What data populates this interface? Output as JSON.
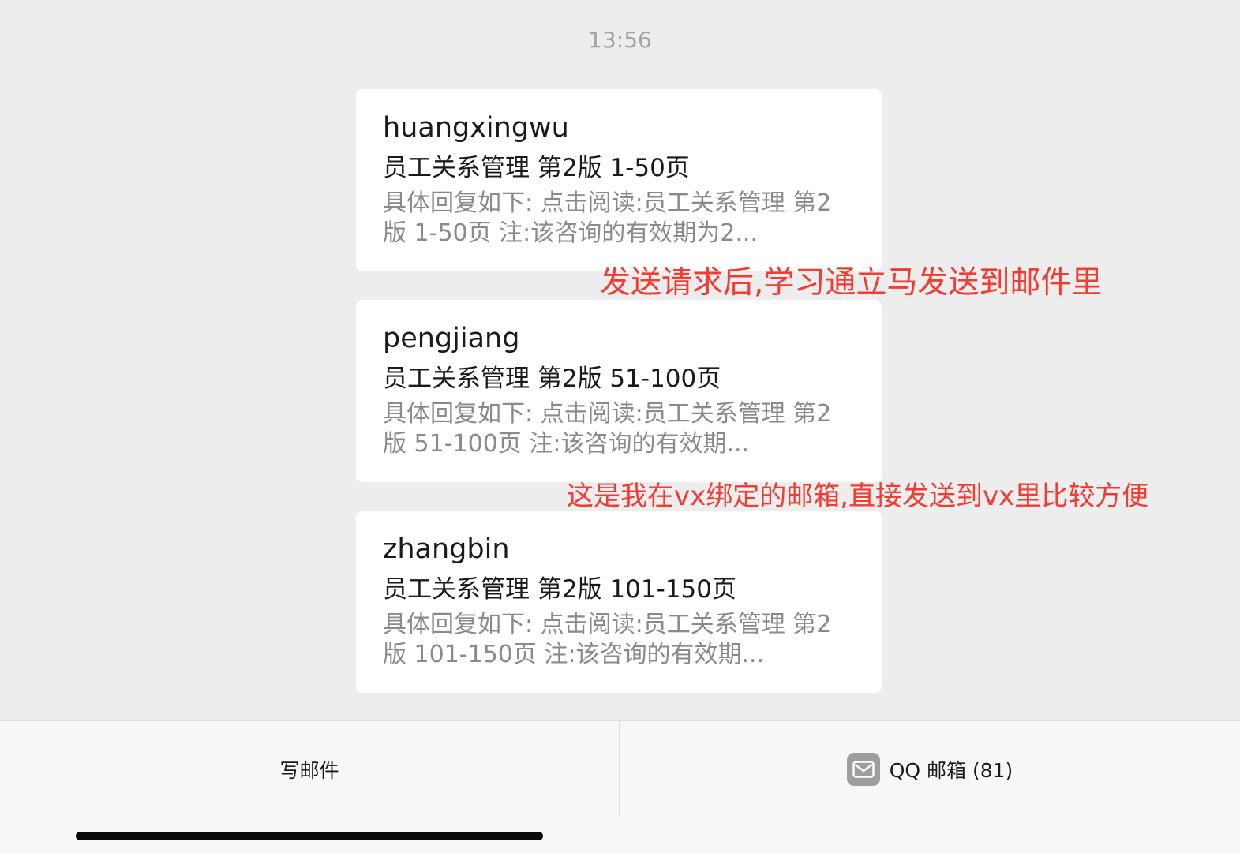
{
  "timestamp": "13:56",
  "messages": [
    {
      "sender": "huangxingwu",
      "subject": "员工关系管理  第2版  1-50页",
      "preview": "具体回复如下:      点击阅读:员工关系管理 第2版  1-50页 注:该咨询的有效期为2..."
    },
    {
      "sender": "pengjiang",
      "subject": "员工关系管理  第2版  51-100页",
      "preview": "具体回复如下:      点击阅读:员工关系管理 第2版  51-100页 注:该咨询的有效期..."
    },
    {
      "sender": "zhangbin",
      "subject": "员工关系管理  第2版  101-150页",
      "preview": "具体回复如下:      点击阅读:员工关系管理 第2版  101-150页 注:该咨询的有效期..."
    }
  ],
  "annotations": [
    "发送请求后,学习通立马发送到邮件里",
    "这是我在vx绑定的邮箱,直接发送到vx里比较方便"
  ],
  "annotation_color": "#f23b33",
  "bottom_bar": {
    "compose_label": "写邮件",
    "mailbox_label": "QQ 邮箱 (81)",
    "mailbox_icon": "envelope-icon"
  }
}
